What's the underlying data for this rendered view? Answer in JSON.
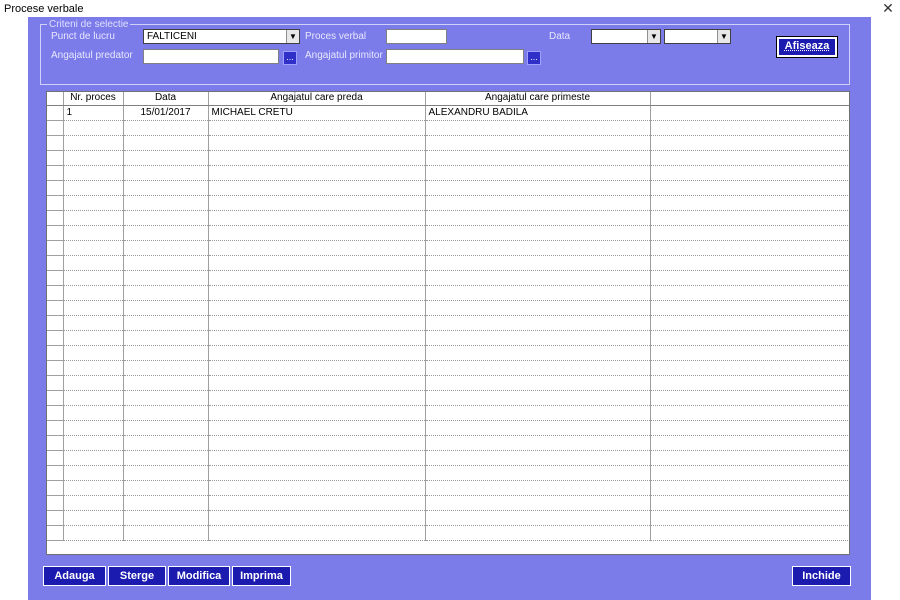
{
  "window": {
    "title": "Procese verbale",
    "close_label": "✕"
  },
  "criteria": {
    "legend": "Criteni de selectie",
    "punct_label": "Punct de lucru",
    "punct_value": "FALTICENI",
    "proces_label": "Proces verbal",
    "proces_value": "",
    "data_label": "Data",
    "data_from": "",
    "data_to": "",
    "predator_label": "Angajatul predator",
    "predator_value": "",
    "primitor_label": "Angajatul primitor",
    "primitor_value": "",
    "dots_label": "...",
    "show_button": "Afiseaza"
  },
  "grid": {
    "columns": [
      "Nr. proces",
      "Data",
      "Angajatul care preda",
      "Angajatul care primeste",
      ""
    ],
    "rows": [
      [
        "1",
        "15/01/2017",
        "MICHAEL CRETU",
        "ALEXANDRU BADILA",
        ""
      ]
    ],
    "empty_rows": 28
  },
  "buttons": {
    "add": "Adauga",
    "delete": "Sterge",
    "modify": "Modifica",
    "print": "Imprima",
    "close": "Inchide"
  },
  "colors": {
    "client_bg": "#7b7bea",
    "button_bg": "#1b1bb0"
  },
  "icons": {
    "dropdown": "chevron-down-icon",
    "close": "close-icon",
    "browse": "ellipsis-icon"
  }
}
